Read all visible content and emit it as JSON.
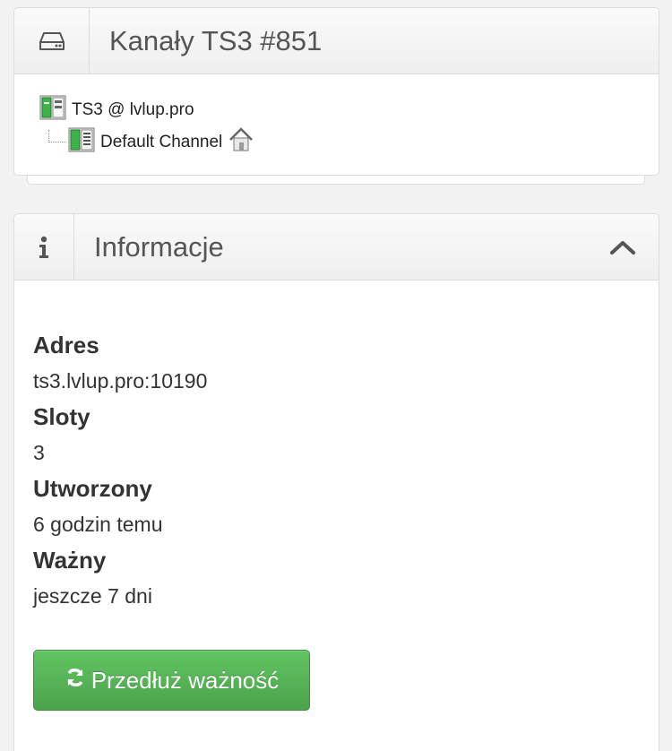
{
  "channels_widget": {
    "title": "Kanały TS3 #851",
    "icon": "hdd-icon",
    "tree": {
      "server_label": "TS3 @ lvlup.pro",
      "channel_label": "Default Channel"
    }
  },
  "info_widget": {
    "title": "Informacje",
    "icon": "info-icon",
    "fields": [
      {
        "label": "Adres",
        "value": "ts3.lvlup.pro:10190"
      },
      {
        "label": "Sloty",
        "value": "3"
      },
      {
        "label": "Utworzony",
        "value": "6 godzin temu"
      },
      {
        "label": "Ważny",
        "value": "jeszcze 7 dni"
      }
    ],
    "extend_button": "Przedłuż ważność"
  },
  "colors": {
    "button_green": "#5bb75b",
    "border": "#dcdcdc"
  }
}
